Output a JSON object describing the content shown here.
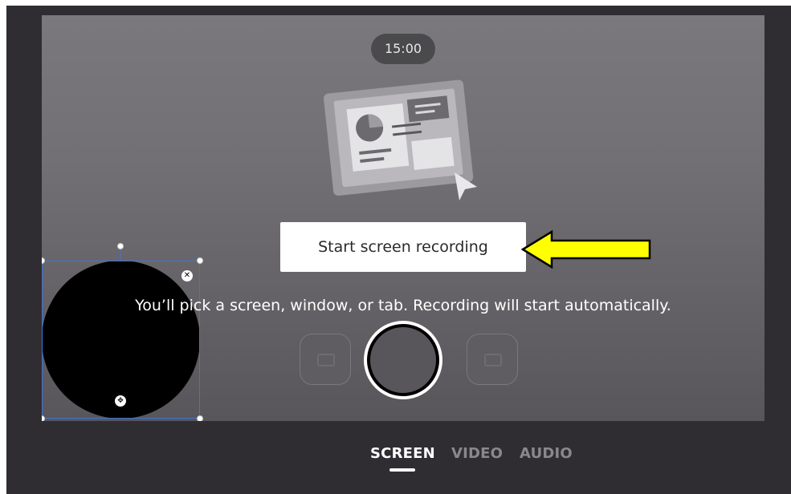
{
  "timer": {
    "text": "15:00"
  },
  "recording": {
    "start_label": "Start screen recording",
    "hint": "You’ll pick a screen, window, or tab. Recording will start automatically."
  },
  "modes": {
    "left_icon": "camera-off-icon",
    "center_icon": "record-icon",
    "right_icon": "screen-icon"
  },
  "camera_overlay": {
    "close_icon": "close-icon",
    "move_icon": "move-icon"
  },
  "tabs": [
    {
      "label": "SCREEN",
      "active": true
    },
    {
      "label": "VIDEO",
      "active": false
    },
    {
      "label": "AUDIO",
      "active": false
    }
  ],
  "annotation": {
    "arrow_color": "#ffff00",
    "arrow_stroke": "#000000"
  },
  "colors": {
    "background": "#2f2d32",
    "stage_top": "#7a787c",
    "stage_bottom": "#58565a",
    "selection": "#3f74d6"
  }
}
